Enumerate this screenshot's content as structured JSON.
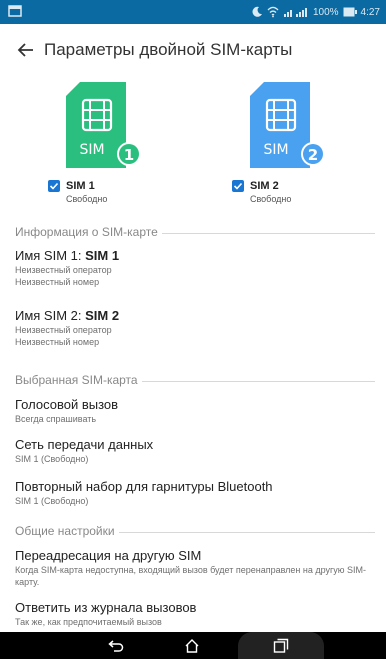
{
  "statusbar": {
    "battery": "100%",
    "time": "4:27"
  },
  "header": {
    "title": "Параметры двойной SIM-карты"
  },
  "sims": [
    {
      "number": "1",
      "card_label": "SIM",
      "name": "SIM 1",
      "status": "Свободно",
      "color": "#2bbf7f"
    },
    {
      "number": "2",
      "card_label": "SIM",
      "name": "SIM 2",
      "status": "Свободно",
      "color": "#4aa1f0"
    }
  ],
  "info_section": {
    "title": "Информация о SIM-карте",
    "sim1": {
      "prefix": "Имя SIM 1: ",
      "name": "SIM 1",
      "operator": "Неизвестный оператор",
      "number": "Неизвестный номер"
    },
    "sim2": {
      "prefix": "Имя SIM 2: ",
      "name": "SIM 2",
      "operator": "Неизвестный оператор",
      "number": "Неизвестный номер"
    }
  },
  "selected_section": {
    "title": "Выбранная SIM-карта",
    "voice": {
      "title": "Голосовой вызов",
      "sub": "Всегда спрашивать"
    },
    "data": {
      "title": "Сеть передачи данных",
      "sub": "SIM 1 (Свободно)"
    },
    "bluetooth": {
      "title": "Повторный набор для гарнитуры Bluetooth",
      "sub": "SIM 1 (Свободно)"
    }
  },
  "general_section": {
    "title": "Общие настройки",
    "forward": {
      "title": "Переадресация на другую SIM",
      "sub": "Когда SIM-карта недоступна, входящий вызов будет перенаправлен на другую SIM-карту."
    },
    "reply": {
      "title": "Ответить из журнала вызовов",
      "sub": "Так же, как предпочитаемый вызов"
    }
  },
  "icons": {
    "back": "back-arrow-icon",
    "home": "home-icon",
    "recent": "recent-apps-icon",
    "nav_back": "nav-back-icon"
  }
}
